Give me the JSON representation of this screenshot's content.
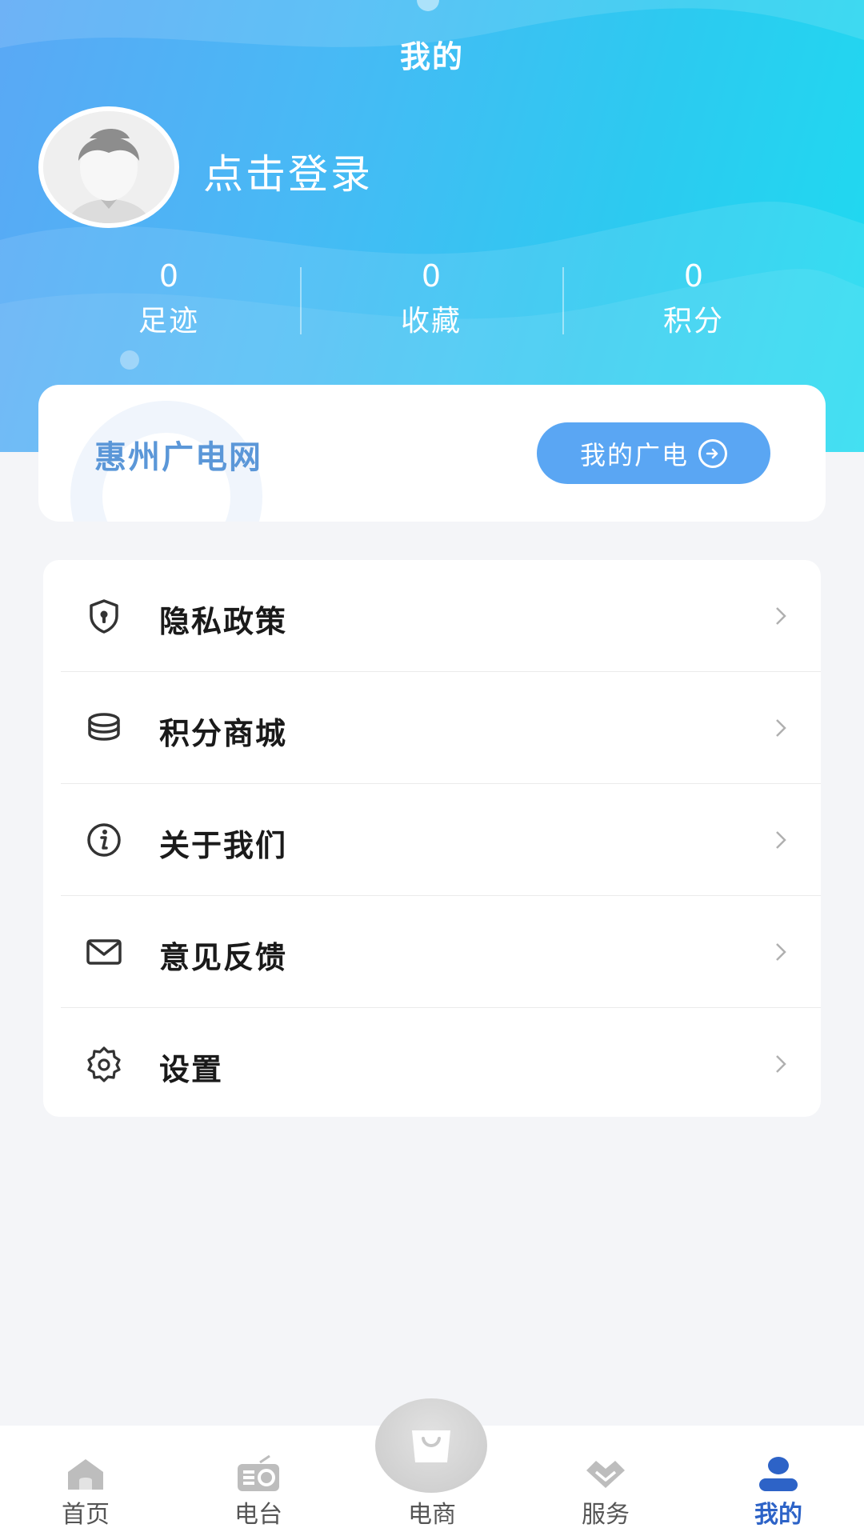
{
  "header": {
    "title": "我的",
    "login_text": "点击登录",
    "stats": [
      {
        "value": "0",
        "label": "足迹"
      },
      {
        "value": "0",
        "label": "收藏"
      },
      {
        "value": "0",
        "label": "积分"
      }
    ]
  },
  "brand": {
    "name": "惠州广电网",
    "button_label": "我的广电"
  },
  "menu": [
    {
      "label": "隐私政策",
      "icon": "shield-lock-icon"
    },
    {
      "label": "积分商城",
      "icon": "coin-stack-icon"
    },
    {
      "label": "关于我们",
      "icon": "info-icon"
    },
    {
      "label": "意见反馈",
      "icon": "mail-icon"
    },
    {
      "label": "设置",
      "icon": "gear-icon"
    }
  ],
  "tabs": [
    {
      "label": "首页",
      "icon": "home-icon"
    },
    {
      "label": "电台",
      "icon": "radio-icon"
    },
    {
      "label": "电商",
      "icon": "shopping-bag-icon"
    },
    {
      "label": "服务",
      "icon": "handshake-icon"
    },
    {
      "label": "我的",
      "icon": "user-icon",
      "active": true
    }
  ],
  "colors": {
    "accent": "#5aa6f3",
    "active_tab": "#2d63c7",
    "brand_text": "#5b97d8"
  }
}
